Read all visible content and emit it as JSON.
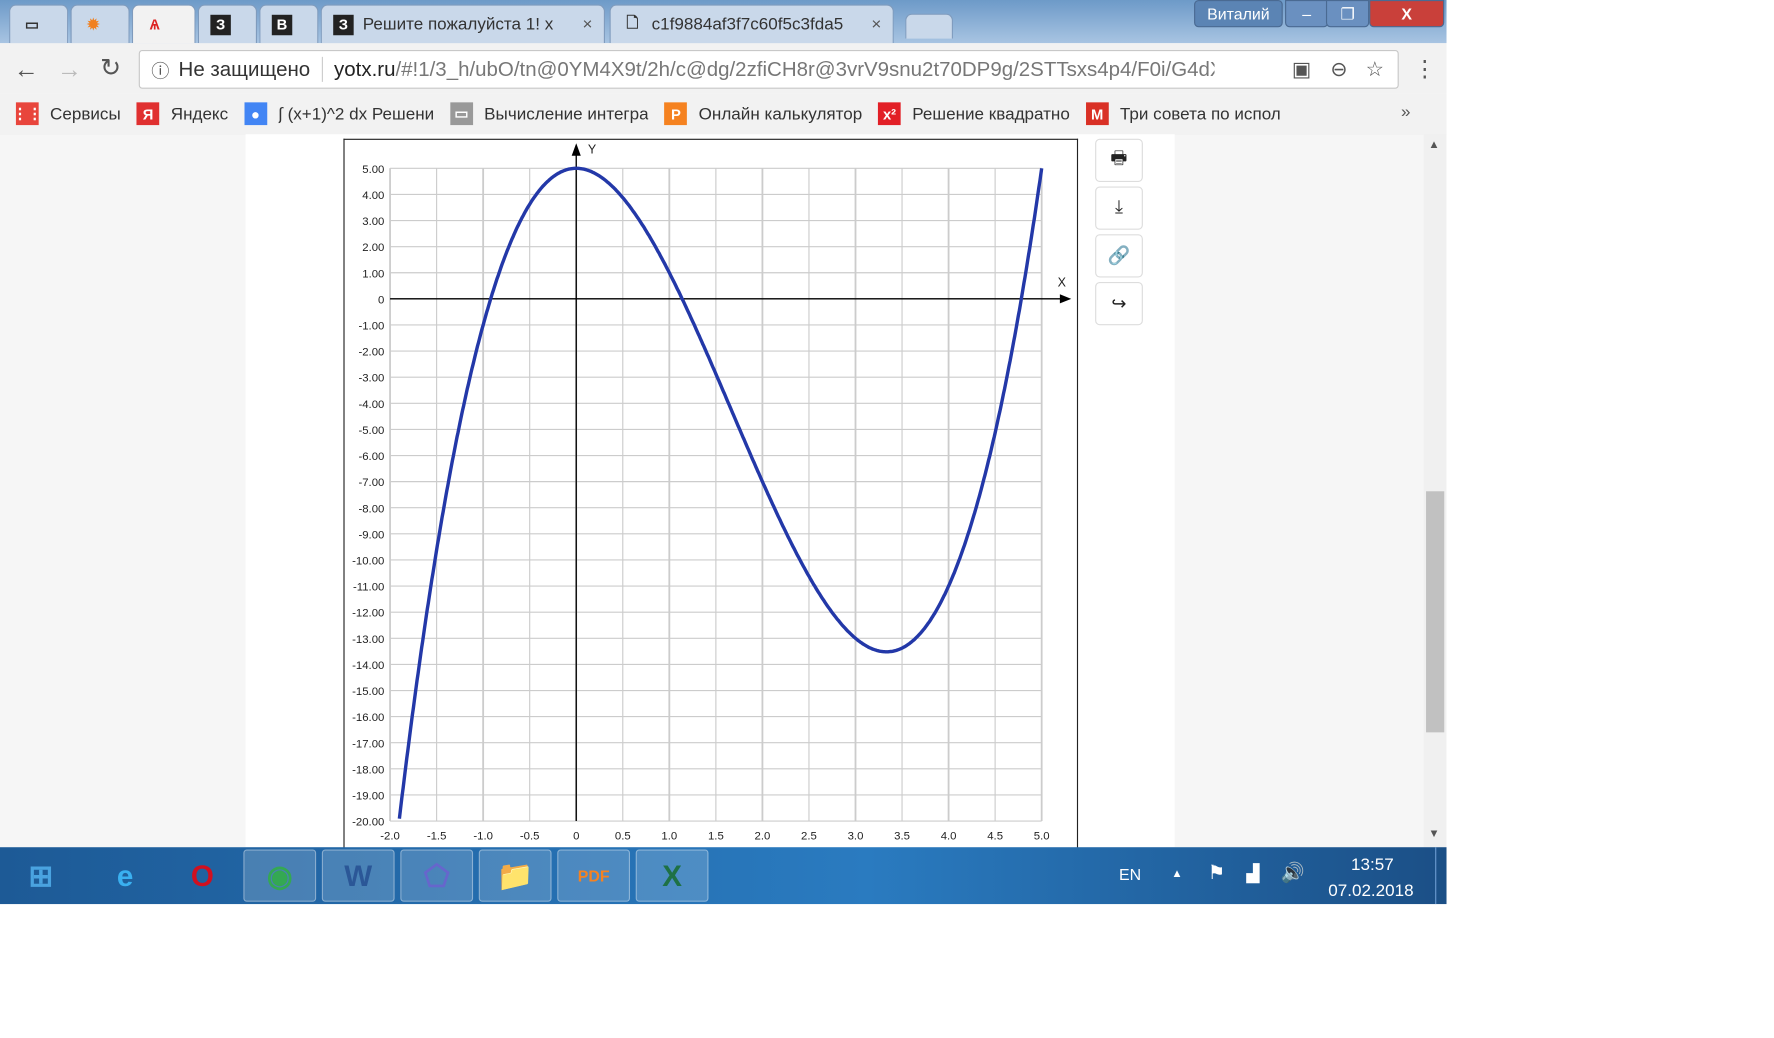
{
  "window": {
    "user": "Виталий",
    "minimize": "–",
    "restore": "❐",
    "close": "X"
  },
  "tabs": [
    {
      "icon": "tv-icon",
      "glyph": "▭",
      "label": ""
    },
    {
      "icon": "sun-icon",
      "glyph": "✹",
      "label": ""
    },
    {
      "icon": "yotx-icon",
      "glyph": "Ѧ",
      "label": "",
      "active": true
    },
    {
      "icon": "z-icon",
      "glyph": "З",
      "label": ""
    },
    {
      "icon": "v-icon",
      "glyph": "В",
      "label": ""
    },
    {
      "icon": "z-icon",
      "glyph": "З",
      "label": "Решите пожалуйста 1! х",
      "close": "×"
    },
    {
      "icon": "page-icon",
      "glyph": "🗋",
      "label": "c1f9884af3f7c60f5c3fda5",
      "close": "×"
    }
  ],
  "address": {
    "security": "Не защищено",
    "domain": "yotx.ru",
    "path": "/#!1/3_h/ubO/tn@0YM4X9t/2h/c@dg/2zfiCH8r@3vrV9snu2t70DP9g/2STTsxs4p4/F0i/G4dX..."
  },
  "bookmarks": [
    {
      "label": "Сервисы",
      "icon": "apps-icon",
      "glyph": "⋮⋮",
      "color": "#e8453c"
    },
    {
      "label": "Яндекс",
      "icon": "yandex-icon",
      "glyph": "Я",
      "color": "#e03030"
    },
    {
      "label": "∫ (x+1)^2 dx Решени",
      "icon": "dots-icon",
      "glyph": "●",
      "color": "#4285f4"
    },
    {
      "label": "Вычисление интегра",
      "icon": "page-icon",
      "glyph": "▭",
      "color": "#999"
    },
    {
      "label": "Онлайн калькулятор",
      "icon": "p-icon",
      "glyph": "P",
      "color": "#f58220"
    },
    {
      "label": "Решение квадратно",
      "icon": "x2-icon",
      "glyph": "x²",
      "color": "#e21f26"
    },
    {
      "label": "Три совета по испол",
      "icon": "gmail-icon",
      "glyph": "M",
      "color": "#d93025"
    }
  ],
  "bookmarks_more": "»",
  "chart_tools": [
    {
      "name": "print-button",
      "icon": "print-icon",
      "glyph": "🖶"
    },
    {
      "name": "download-button",
      "icon": "download-icon",
      "glyph": "⤓"
    },
    {
      "name": "link-button",
      "icon": "link-icon",
      "glyph": "🔗"
    },
    {
      "name": "share-button",
      "icon": "share-icon",
      "glyph": "↪"
    }
  ],
  "chart_data": {
    "type": "line",
    "function": "y = x^3 - 5x^2 + 5",
    "xlabel": "X",
    "ylabel": "Y",
    "xlim": [
      -2,
      5
    ],
    "ylim": [
      -20,
      5
    ],
    "grid": true,
    "x_ticks": [
      "-2.0",
      "-1.5",
      "-1.0",
      "-0.5",
      "0",
      "0.5",
      "1.0",
      "1.5",
      "2.0",
      "2.5",
      "3.0",
      "3.5",
      "4.0",
      "4.5",
      "5.0"
    ],
    "y_ticks": [
      "5.00",
      "4.00",
      "3.00",
      "2.00",
      "1.00",
      "0",
      "-1.00",
      "-2.00",
      "-3.00",
      "-4.00",
      "-5.00",
      "-6.00",
      "-7.00",
      "-8.00",
      "-9.00",
      "-10.00",
      "-11.00",
      "-12.00",
      "-13.00",
      "-14.00",
      "-15.00",
      "-16.00",
      "-17.00",
      "-18.00",
      "-19.00",
      "-20.00"
    ],
    "series": [
      {
        "color": "#2338a8",
        "points": [
          [
            -1.9,
            -19.9
          ],
          [
            -1.5,
            -9.6
          ],
          [
            -1,
            -1
          ],
          [
            -0.5,
            3.63
          ],
          [
            0,
            5
          ],
          [
            0.5,
            3.88
          ],
          [
            1,
            1
          ],
          [
            1.5,
            -2.88
          ],
          [
            2,
            -7
          ],
          [
            2.5,
            -10.63
          ],
          [
            3,
            -13
          ],
          [
            3.33,
            -13.52
          ],
          [
            3.5,
            -13.38
          ],
          [
            4,
            -11
          ],
          [
            4.5,
            -5.13
          ],
          [
            5,
            5
          ]
        ]
      }
    ]
  },
  "taskbar": {
    "apps": [
      {
        "icon": "start-icon",
        "glyph": "⊞",
        "color": "#4aa3e0"
      },
      {
        "icon": "ie-icon",
        "glyph": "e",
        "color": "#3ab0f0"
      },
      {
        "icon": "opera-icon",
        "glyph": "O",
        "color": "#d01020"
      },
      {
        "icon": "chrome-icon",
        "glyph": "◉",
        "color": "#34a853",
        "pinned": true
      },
      {
        "icon": "word-icon",
        "glyph": "W",
        "color": "#2b5797",
        "pinned": true
      },
      {
        "icon": "geogebra-icon",
        "glyph": "⬠",
        "color": "#6666cc",
        "pinned": true
      },
      {
        "icon": "explorer-icon",
        "glyph": "📁",
        "color": "#f0d070",
        "pinned": true
      },
      {
        "icon": "pdf-icon",
        "glyph": "PDF",
        "color": "#f58220",
        "pinned": true
      },
      {
        "icon": "excel-icon",
        "glyph": "X",
        "color": "#1e7145",
        "pinned": true
      }
    ],
    "lang": "EN",
    "time": "13:57",
    "date": "07.02.2018"
  }
}
